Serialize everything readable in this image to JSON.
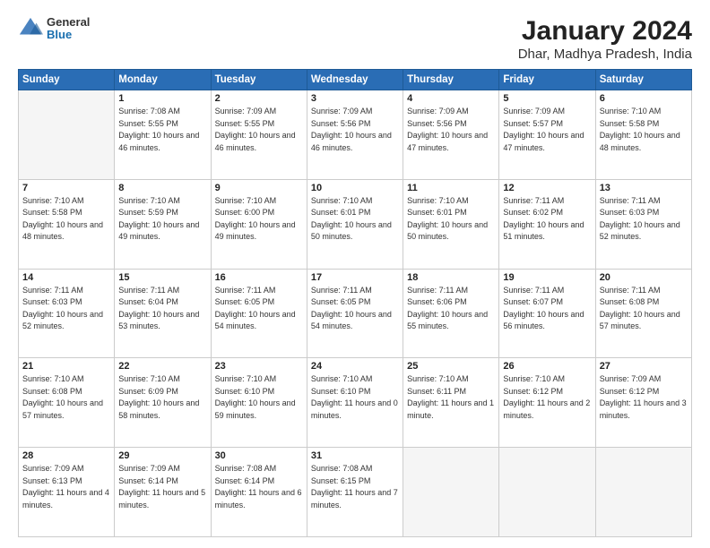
{
  "header": {
    "logo_general": "General",
    "logo_blue": "Blue",
    "title": "January 2024",
    "subtitle": "Dhar, Madhya Pradesh, India"
  },
  "calendar": {
    "days_of_week": [
      "Sunday",
      "Monday",
      "Tuesday",
      "Wednesday",
      "Thursday",
      "Friday",
      "Saturday"
    ],
    "weeks": [
      [
        {
          "day": "",
          "empty": true
        },
        {
          "day": "1",
          "sunrise": "7:08 AM",
          "sunset": "5:55 PM",
          "daylight": "10 hours and 46 minutes."
        },
        {
          "day": "2",
          "sunrise": "7:09 AM",
          "sunset": "5:55 PM",
          "daylight": "10 hours and 46 minutes."
        },
        {
          "day": "3",
          "sunrise": "7:09 AM",
          "sunset": "5:56 PM",
          "daylight": "10 hours and 46 minutes."
        },
        {
          "day": "4",
          "sunrise": "7:09 AM",
          "sunset": "5:56 PM",
          "daylight": "10 hours and 47 minutes."
        },
        {
          "day": "5",
          "sunrise": "7:09 AM",
          "sunset": "5:57 PM",
          "daylight": "10 hours and 47 minutes."
        },
        {
          "day": "6",
          "sunrise": "7:10 AM",
          "sunset": "5:58 PM",
          "daylight": "10 hours and 48 minutes."
        }
      ],
      [
        {
          "day": "7",
          "sunrise": "7:10 AM",
          "sunset": "5:58 PM",
          "daylight": "10 hours and 48 minutes."
        },
        {
          "day": "8",
          "sunrise": "7:10 AM",
          "sunset": "5:59 PM",
          "daylight": "10 hours and 49 minutes."
        },
        {
          "day": "9",
          "sunrise": "7:10 AM",
          "sunset": "6:00 PM",
          "daylight": "10 hours and 49 minutes."
        },
        {
          "day": "10",
          "sunrise": "7:10 AM",
          "sunset": "6:01 PM",
          "daylight": "10 hours and 50 minutes."
        },
        {
          "day": "11",
          "sunrise": "7:10 AM",
          "sunset": "6:01 PM",
          "daylight": "10 hours and 50 minutes."
        },
        {
          "day": "12",
          "sunrise": "7:11 AM",
          "sunset": "6:02 PM",
          "daylight": "10 hours and 51 minutes."
        },
        {
          "day": "13",
          "sunrise": "7:11 AM",
          "sunset": "6:03 PM",
          "daylight": "10 hours and 52 minutes."
        }
      ],
      [
        {
          "day": "14",
          "sunrise": "7:11 AM",
          "sunset": "6:03 PM",
          "daylight": "10 hours and 52 minutes."
        },
        {
          "day": "15",
          "sunrise": "7:11 AM",
          "sunset": "6:04 PM",
          "daylight": "10 hours and 53 minutes."
        },
        {
          "day": "16",
          "sunrise": "7:11 AM",
          "sunset": "6:05 PM",
          "daylight": "10 hours and 54 minutes."
        },
        {
          "day": "17",
          "sunrise": "7:11 AM",
          "sunset": "6:05 PM",
          "daylight": "10 hours and 54 minutes."
        },
        {
          "day": "18",
          "sunrise": "7:11 AM",
          "sunset": "6:06 PM",
          "daylight": "10 hours and 55 minutes."
        },
        {
          "day": "19",
          "sunrise": "7:11 AM",
          "sunset": "6:07 PM",
          "daylight": "10 hours and 56 minutes."
        },
        {
          "day": "20",
          "sunrise": "7:11 AM",
          "sunset": "6:08 PM",
          "daylight": "10 hours and 57 minutes."
        }
      ],
      [
        {
          "day": "21",
          "sunrise": "7:10 AM",
          "sunset": "6:08 PM",
          "daylight": "10 hours and 57 minutes."
        },
        {
          "day": "22",
          "sunrise": "7:10 AM",
          "sunset": "6:09 PM",
          "daylight": "10 hours and 58 minutes."
        },
        {
          "day": "23",
          "sunrise": "7:10 AM",
          "sunset": "6:10 PM",
          "daylight": "10 hours and 59 minutes."
        },
        {
          "day": "24",
          "sunrise": "7:10 AM",
          "sunset": "6:10 PM",
          "daylight": "11 hours and 0 minutes."
        },
        {
          "day": "25",
          "sunrise": "7:10 AM",
          "sunset": "6:11 PM",
          "daylight": "11 hours and 1 minute."
        },
        {
          "day": "26",
          "sunrise": "7:10 AM",
          "sunset": "6:12 PM",
          "daylight": "11 hours and 2 minutes."
        },
        {
          "day": "27",
          "sunrise": "7:09 AM",
          "sunset": "6:12 PM",
          "daylight": "11 hours and 3 minutes."
        }
      ],
      [
        {
          "day": "28",
          "sunrise": "7:09 AM",
          "sunset": "6:13 PM",
          "daylight": "11 hours and 4 minutes."
        },
        {
          "day": "29",
          "sunrise": "7:09 AM",
          "sunset": "6:14 PM",
          "daylight": "11 hours and 5 minutes."
        },
        {
          "day": "30",
          "sunrise": "7:08 AM",
          "sunset": "6:14 PM",
          "daylight": "11 hours and 6 minutes."
        },
        {
          "day": "31",
          "sunrise": "7:08 AM",
          "sunset": "6:15 PM",
          "daylight": "11 hours and 7 minutes."
        },
        {
          "day": "",
          "empty": true
        },
        {
          "day": "",
          "empty": true
        },
        {
          "day": "",
          "empty": true
        }
      ]
    ]
  }
}
